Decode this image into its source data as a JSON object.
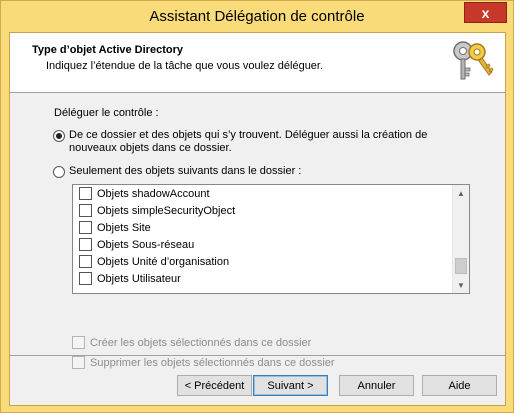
{
  "window": {
    "title": "Assistant Délégation de contrôle",
    "close_glyph": "x"
  },
  "header": {
    "title": "Type d’objet Active Directory",
    "subtitle": "Indiquez l’étendue de la tâche que vous voulez déléguer.",
    "icon": "keys-icon"
  },
  "delegation": {
    "label": "Déléguer le contrôle :",
    "options": [
      {
        "label": "De ce dossier et des objets qui s’y trouvent. Déléguer aussi la création de nouveaux objets dans ce dossier.",
        "selected": true
      },
      {
        "label": "Seulement des objets suivants dans le dossier :",
        "selected": false
      }
    ]
  },
  "object_list": {
    "items": [
      {
        "label": "Objets shadowAccount",
        "checked": false
      },
      {
        "label": "Objets simpleSecurityObject",
        "checked": false
      },
      {
        "label": "Objets Site",
        "checked": false
      },
      {
        "label": "Objets Sous-réseau",
        "checked": false
      },
      {
        "label": "Objets Unité d’organisation",
        "checked": false
      },
      {
        "label": "Objets Utilisateur",
        "checked": false
      }
    ],
    "scroll_position": 0.92
  },
  "sub_options": {
    "create": {
      "label": "Créer les objets sélectionnés dans ce dossier",
      "checked": false,
      "enabled": false
    },
    "delete": {
      "label": "Supprimer les objets sélectionnés dans ce dossier",
      "checked": false,
      "enabled": false
    }
  },
  "buttons": {
    "back": "< Précédent",
    "next": "Suivant >",
    "cancel": "Annuler",
    "help": "Aide"
  },
  "colors": {
    "title_bar": "#fadb7a",
    "close_button": "#c7382a",
    "dialog_bg": "#f0f0f0"
  }
}
